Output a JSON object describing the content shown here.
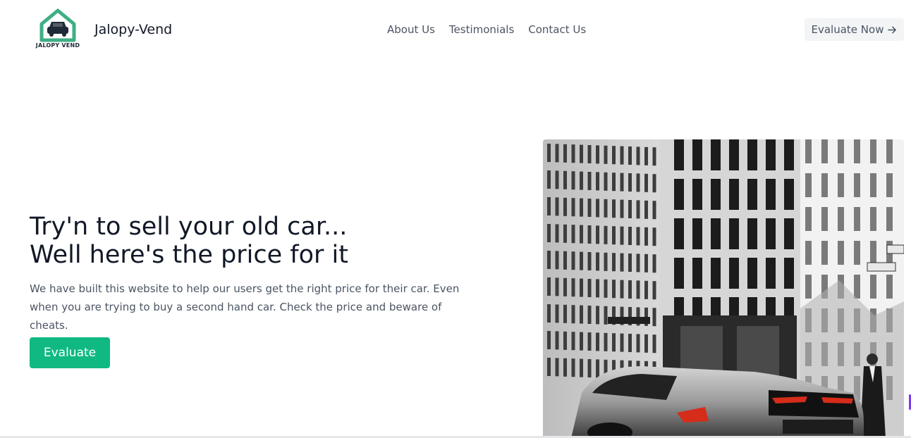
{
  "header": {
    "logo_text": "JALOPY VEND",
    "brand": "Jalopy-Vend",
    "nav": [
      {
        "label": "About Us"
      },
      {
        "label": "Testimonials"
      },
      {
        "label": "Contact Us"
      }
    ],
    "cta_label": "Evaluate Now"
  },
  "hero": {
    "headline_line1": "Try'n to sell your old car...",
    "headline_line2": "Well here's the price for it",
    "description": "We have built this website to help our users get the right price for their car. Even when you are trying to buy a second hand car. Check the price and beware of cheats.",
    "button_label": "Evaluate",
    "image_subject": "black-and-white photo of a sports car parked in front of an office building"
  },
  "colors": {
    "accent": "#10b981",
    "logo_green": "#3fae84",
    "text_dark": "#111827",
    "text_muted": "#4b5563",
    "button_gray": "#f3f4f6"
  },
  "icons": [
    "car-house-logo-icon",
    "arrow-right-icon"
  ]
}
